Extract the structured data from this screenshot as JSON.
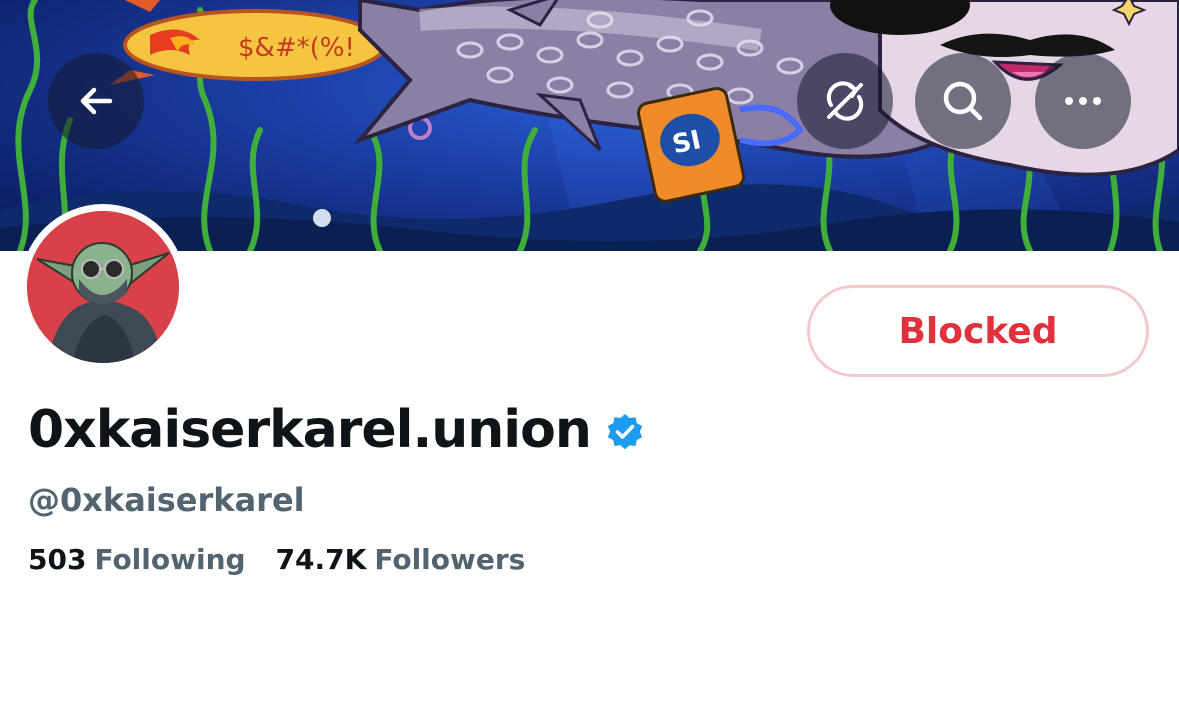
{
  "banner": {
    "surfboard_text": "$&#*(%!",
    "can_text": "SI"
  },
  "header_buttons": {
    "back_icon": "arrow-left-icon",
    "sync_icon": "sync-off-icon",
    "search_icon": "search-icon",
    "more_icon": "more-horizontal-icon"
  },
  "profile": {
    "display_name": "0xkaiserkarel.union",
    "handle": "@0xkaiserkarel",
    "verified": true,
    "block_button_label": "Blocked",
    "following_count": "503",
    "following_label": "Following",
    "followers_count": "74.7K",
    "followers_label": "Followers"
  },
  "colors": {
    "blocked_red": "#e0313d",
    "verified_blue": "#1d9bf0",
    "muted_text": "#536471",
    "primary_text": "#0f1419"
  }
}
